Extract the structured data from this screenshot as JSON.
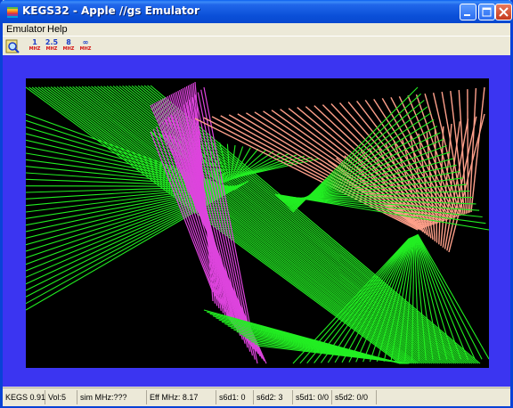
{
  "window": {
    "title": "KEGS32 - Apple //gs Emulator"
  },
  "menu": [
    {
      "label": "Emulator"
    },
    {
      "label": "Help"
    }
  ],
  "toolbar": {
    "speeds": [
      {
        "label": "1",
        "unit": "MHZ"
      },
      {
        "label": "2.5",
        "unit": "MHZ"
      },
      {
        "label": "8",
        "unit": "MHZ"
      },
      {
        "label": "∞",
        "unit": "MHZ"
      }
    ]
  },
  "status": {
    "version": "KEGS 0.91",
    "volume": "Vol:5",
    "sim_mhz": "sim MHz:???",
    "eff_mhz_label": "Eff MHz:",
    "eff_mhz_value": "8.17",
    "s6d1": "s6d1: 0",
    "s6d2": "s6d2: 3",
    "s5d1": "s5d1: 0/0",
    "s5d2": "s5d2: 0/0"
  },
  "colors": {
    "titlebar": "#0A4FD8",
    "border": "#3B35F1",
    "screen": "#000000",
    "green": "#22EE22",
    "magenta": "#DD44DD",
    "salmon": "#FFA08A"
  }
}
